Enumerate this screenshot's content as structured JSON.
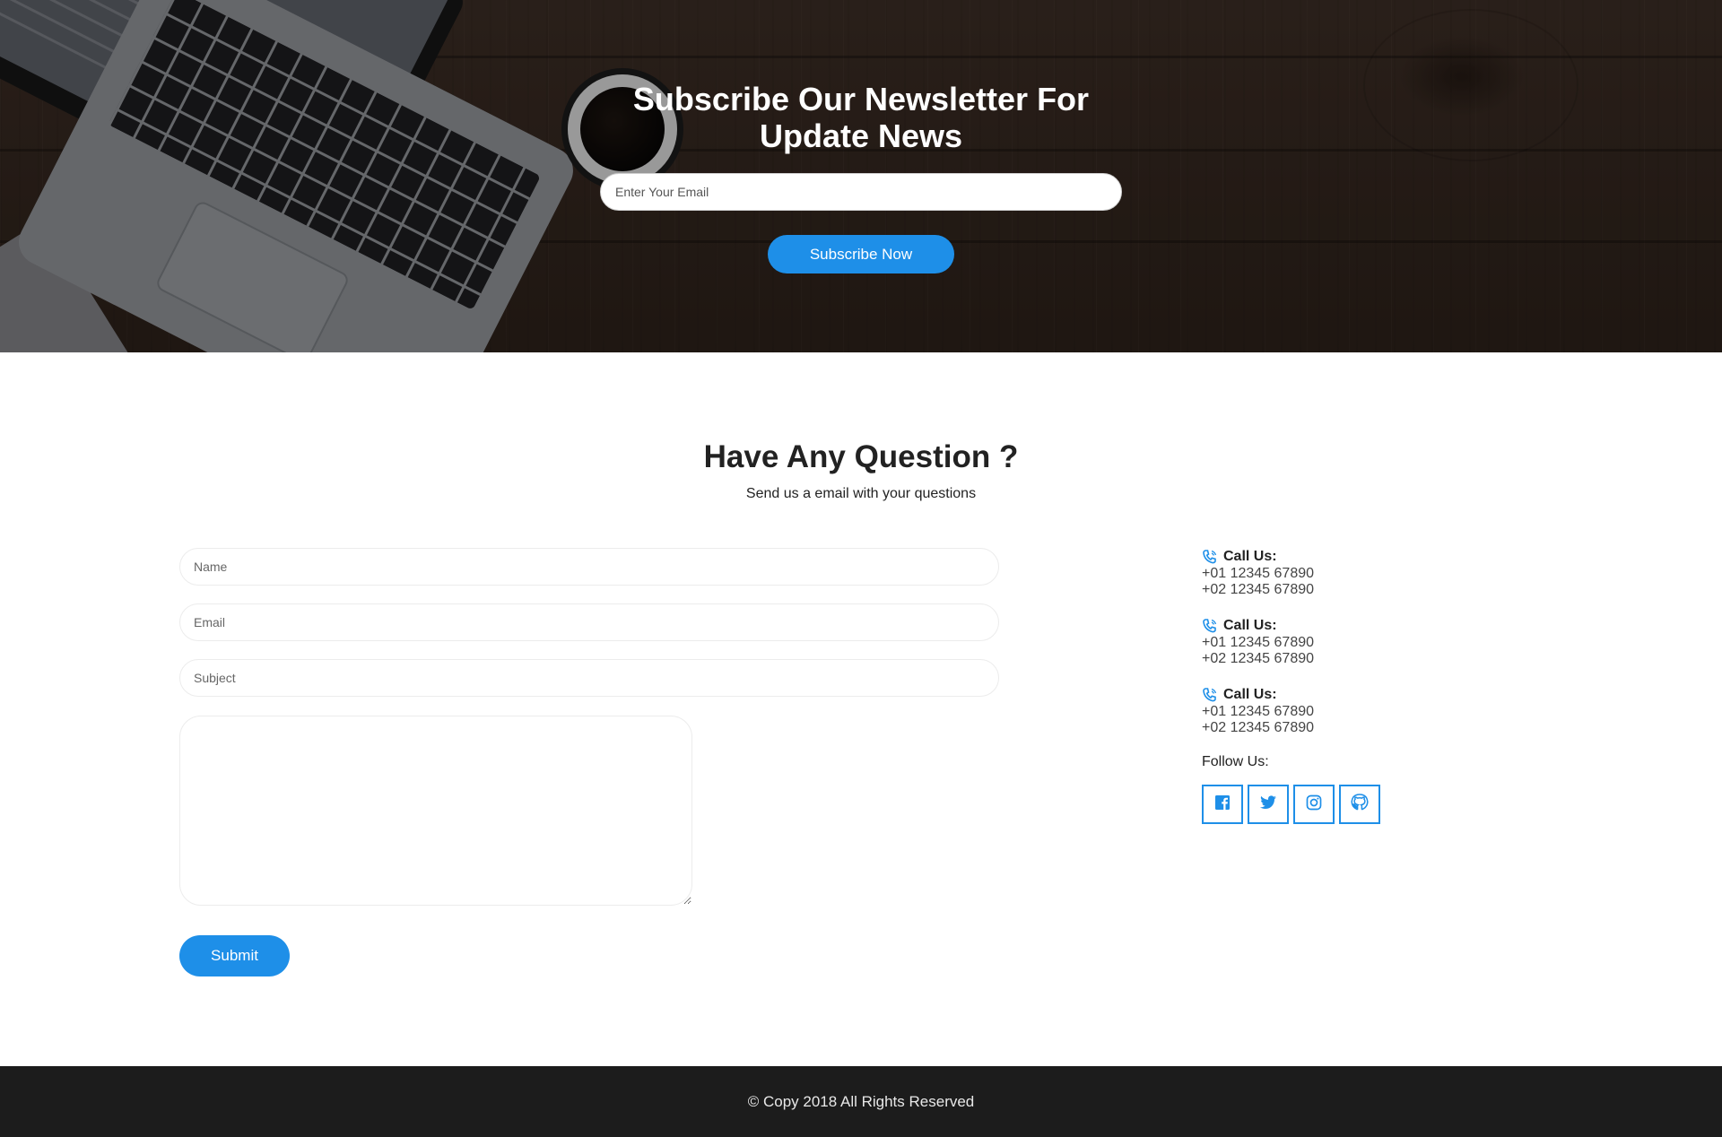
{
  "newsletter": {
    "title": "Subscribe Our Newsletter For Update News",
    "email_placeholder": "Enter Your Email",
    "button_label": "Subscribe Now"
  },
  "contact": {
    "title": "Have Any Question ?",
    "subtitle": "Send us a email with your questions",
    "name_placeholder": "Name",
    "email_placeholder": "Email",
    "subject_placeholder": "Subject",
    "message_placeholder": "",
    "submit_label": "Submit"
  },
  "info": {
    "blocks": [
      {
        "label": "Call Us:",
        "lines": [
          "+01 12345 67890",
          "+02 12345 67890"
        ],
        "icon": "phone-icon"
      },
      {
        "label": "Call Us:",
        "lines": [
          "+01 12345 67890",
          "+02 12345 67890"
        ],
        "icon": "phone-icon"
      },
      {
        "label": "Call Us:",
        "lines": [
          "+01 12345 67890",
          "+02 12345 67890"
        ],
        "icon": "phone-icon"
      }
    ],
    "follow_label": "Follow Us:",
    "social": [
      "facebook-icon",
      "twitter-icon",
      "instagram-icon",
      "github-icon"
    ]
  },
  "footer": {
    "copyright": "© Copy 2018 All Rights Reserved"
  },
  "colors": {
    "accent": "#1e8fe8",
    "footer_bg": "#1c1c1c"
  }
}
